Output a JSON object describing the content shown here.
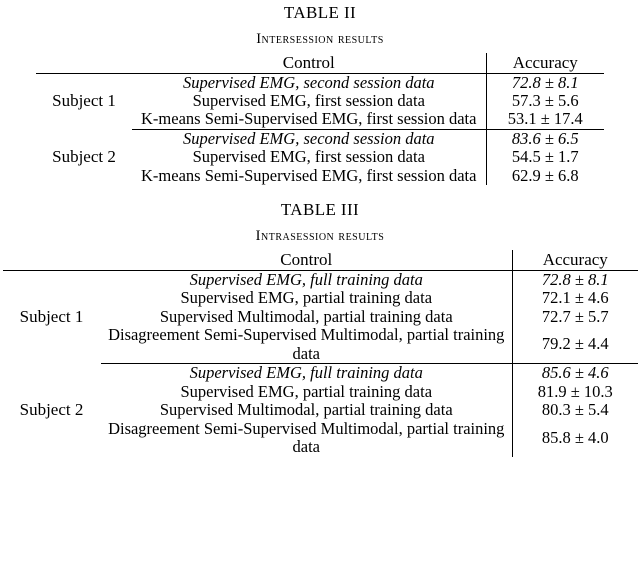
{
  "tables": [
    {
      "title": "TABLE II",
      "subtitle": "Intersession results",
      "columns": {
        "subject": "",
        "control": "Control",
        "accuracy": "Accuracy"
      },
      "groups": [
        {
          "subject": "Subject 1",
          "rows": [
            {
              "control": "Supervised EMG, second session data",
              "accuracy": "72.8 ± 8.1",
              "control_style": "italic",
              "accuracy_style": "italic"
            },
            {
              "control": "Supervised EMG, first session data",
              "accuracy": "57.3 ± 5.6",
              "control_style": "normal",
              "accuracy_style": "bold"
            },
            {
              "control": "K-means Semi-Supervised EMG, first session data",
              "accuracy": "53.1 ± 17.4",
              "control_style": "normal",
              "accuracy_style": "normal"
            }
          ]
        },
        {
          "subject": "Subject 2",
          "rows": [
            {
              "control": "Supervised EMG, second session data",
              "accuracy": "83.6 ± 6.5",
              "control_style": "italic",
              "accuracy_style": "italic"
            },
            {
              "control": "Supervised EMG, first session data",
              "accuracy": "54.5 ± 1.7",
              "control_style": "normal",
              "accuracy_style": "normal"
            },
            {
              "control": "K-means Semi-Supervised EMG, first session data",
              "accuracy": "62.9 ± 6.8",
              "control_style": "normal",
              "accuracy_style": "bold"
            }
          ]
        }
      ]
    },
    {
      "title": "TABLE III",
      "subtitle": "Intrasession results",
      "columns": {
        "subject": "",
        "control": "Control",
        "accuracy": "Accuracy"
      },
      "groups": [
        {
          "subject": "Subject 1",
          "rows": [
            {
              "control": "Supervised EMG, full training data",
              "accuracy": "72.8 ± 8.1",
              "control_style": "italic",
              "accuracy_style": "italic"
            },
            {
              "control": "Supervised EMG, partial training data",
              "accuracy": "72.1 ± 4.6",
              "control_style": "normal",
              "accuracy_style": "normal"
            },
            {
              "control": "Supervised Multimodal, partial training data",
              "accuracy": "72.7 ± 5.7",
              "control_style": "normal",
              "accuracy_style": "normal"
            },
            {
              "control": "Disagreement Semi-Supervised Multimodal, partial training data",
              "accuracy": "79.2 ± 4.4",
              "control_style": "normal",
              "accuracy_style": "bold"
            }
          ]
        },
        {
          "subject": "Subject 2",
          "rows": [
            {
              "control": "Supervised EMG, full training data",
              "accuracy": "85.6 ± 4.6",
              "control_style": "italic",
              "accuracy_style": "italic"
            },
            {
              "control": "Supervised EMG, partial training data",
              "accuracy": "81.9 ± 10.3",
              "control_style": "normal",
              "accuracy_style": "normal"
            },
            {
              "control": "Supervised Multimodal, partial training data",
              "accuracy": "80.3 ± 5.4",
              "control_style": "normal",
              "accuracy_style": "normal"
            },
            {
              "control": "Disagreement Semi-Supervised Multimodal, partial training data",
              "accuracy": "85.8 ± 4.0",
              "control_style": "normal",
              "accuracy_style": "bold"
            }
          ]
        }
      ]
    }
  ]
}
